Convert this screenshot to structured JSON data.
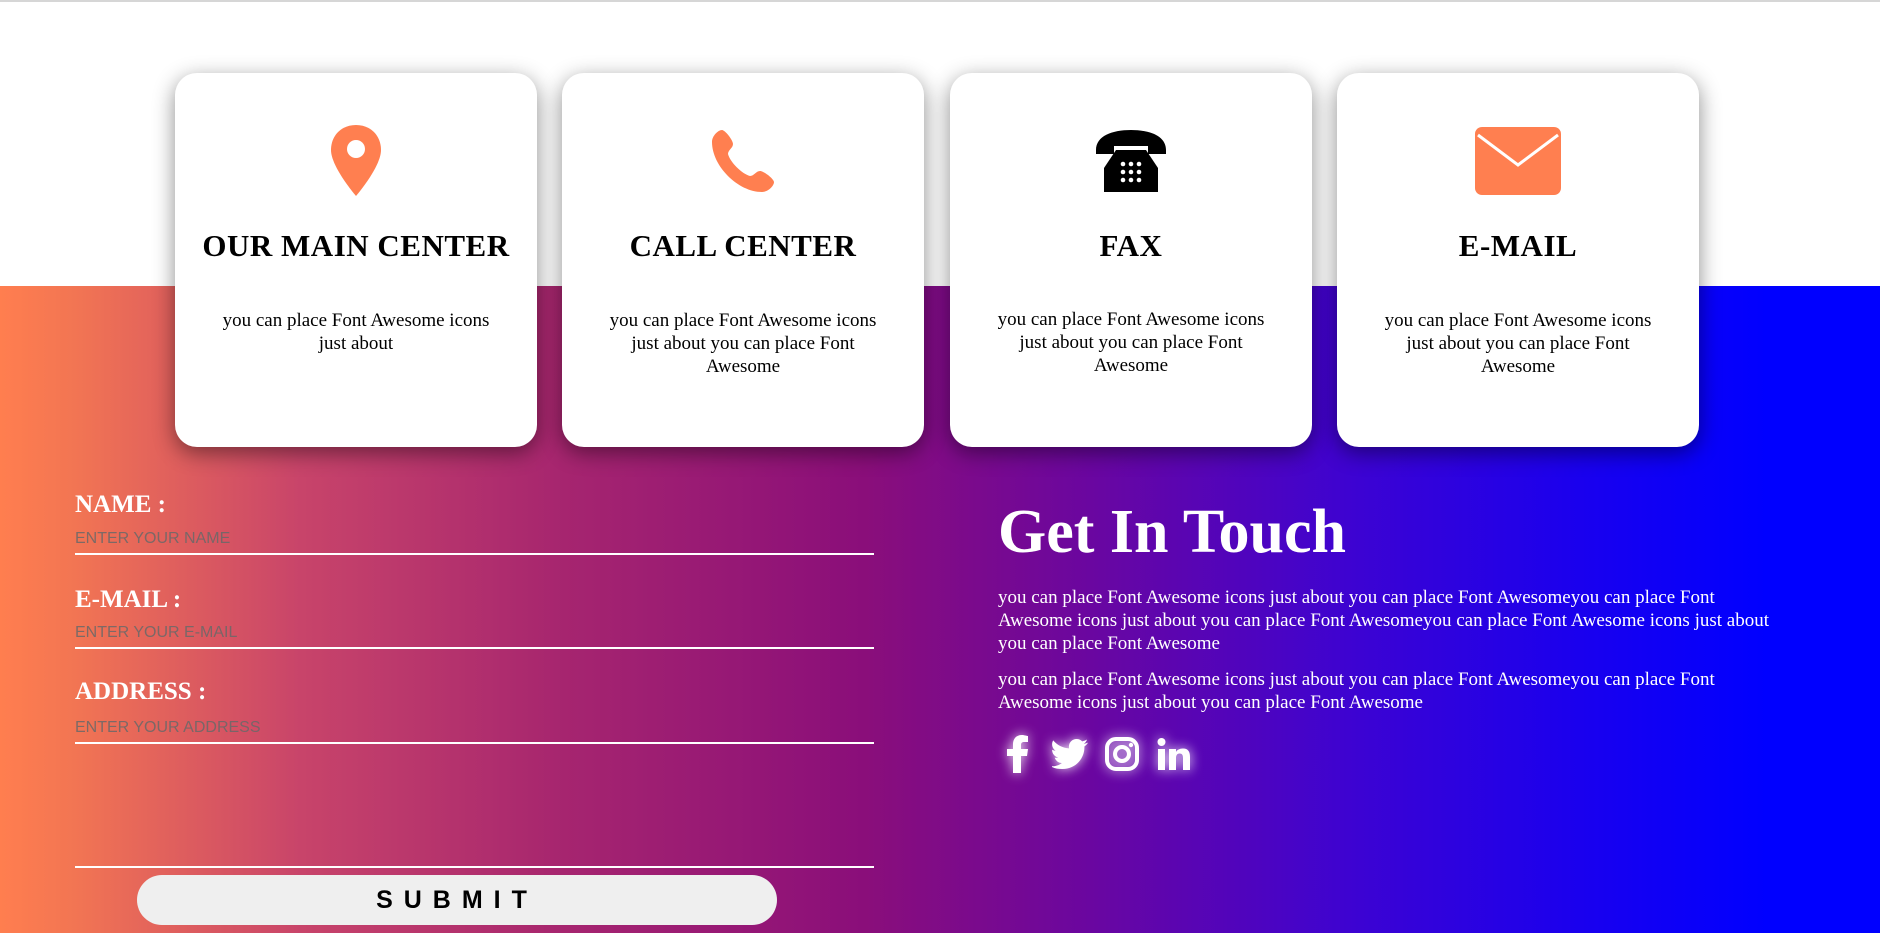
{
  "cards": [
    {
      "title": "OUR MAIN CENTER",
      "text": "you can place Font Awesome icons just about",
      "icon": "map-marker-icon",
      "icon_color": "#ff7f50"
    },
    {
      "title": "CALL CENTER",
      "text": "you can place Font Awesome icons just about you can place Font Awesome",
      "icon": "phone-icon",
      "icon_color": "#ff7f50"
    },
    {
      "title": "FAX",
      "text": "you can place Font Awesome icons just about you can place Font Awesome",
      "icon": "fax-icon",
      "icon_color": "#000000"
    },
    {
      "title": "E-MAIL",
      "text": "you can place Font Awesome icons just about you can place Font Awesome",
      "icon": "envelope-icon",
      "icon_color": "#ff7f50"
    }
  ],
  "form": {
    "name_label": "NAME :",
    "name_placeholder": "ENTER YOUR NAME",
    "email_label": "E-MAIL :",
    "email_placeholder": "ENTER YOUR E-MAIL",
    "address_label": "ADDRESS :",
    "address_placeholder": "ENTER YOUR ADDRESS",
    "submit_label": "SUBMIT"
  },
  "touch": {
    "title": "Get In Touch",
    "paragraph1": "you can place Font Awesome icons just about you can place Font Awesomeyou can place Font Awesome icons just about you can place Font Awesomeyou can place Font Awesome icons just about you can place Font Awesome",
    "paragraph2": "you can place Font Awesome icons just about you can place Font Awesomeyou can place Font Awesome icons just about you can place Font Awesome",
    "social": [
      "facebook-icon",
      "twitter-icon",
      "instagram-icon",
      "linkedin-icon"
    ]
  },
  "colors": {
    "accent": "#ff7f50",
    "gradient_start": "#ff7e4f",
    "gradient_mid": "#8a0e7a",
    "gradient_end": "#0000ff"
  }
}
